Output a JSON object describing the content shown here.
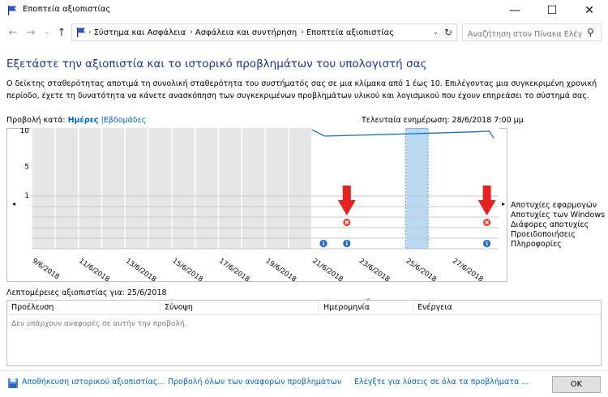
{
  "window": {
    "title": "Εποπτεία αξιοπιστίας",
    "minimize_glyph": "—",
    "maximize_glyph": "☐",
    "close_glyph": "✕"
  },
  "nav": {
    "back_glyph": "←",
    "forward_glyph": "→",
    "up_glyph": "↑",
    "history_glyph": "⌄",
    "breadcrumbs": [
      "Σύστημα και Ασφάλεια",
      "Ασφάλεια και συντήρηση",
      "Εποπτεία αξιοπιστίας"
    ],
    "refresh_glyph": "↻",
    "dropdown_glyph": "⌄",
    "search_placeholder": "Αναζήτηση στον Πίνακα Ελέγ...",
    "search_icon_glyph": "⚲"
  },
  "page": {
    "title": "Εξετάστε την αξιοπιστία και το ιστορικό προβλημάτων του υπολογιστή σας",
    "description": "Ο δείκτης σταθερότητας αποτιμά τη συνολική σταθερότητα του συστήματός σας σε μια κλίμακα από 1 έως 10. Επιλέγοντας μια συγκεκριμένη χρονική περίοδο, έχετε τη δυνατότητα να κάνετε ανασκόπηση των συγκεκριμένων προβλημάτων υλικού και λογισμικού που έχουν επηρεάσει το σύστημά σας.",
    "view_by_label": "Προβολή κατά:",
    "view_days": "Ημέρες",
    "view_sep": "|",
    "view_weeks": "Εβδομάδες",
    "last_update": "Τελευταία ενημέρωση: 28/6/2018 7:00 μμ"
  },
  "chart_data": {
    "type": "line",
    "title": "",
    "xlabel": "",
    "ylabel": "",
    "ylim": [
      1,
      10
    ],
    "y_ticks": [
      10,
      5,
      1
    ],
    "x_tick_labels": [
      "9/6/2018",
      "11/6/2018",
      "13/6/2018",
      "15/6/2018",
      "17/6/2018",
      "19/6/2018",
      "21/6/2018",
      "23/6/2018",
      "25/6/2018",
      "27/6/2018"
    ],
    "day_count": 20,
    "selected_day_index": 16,
    "no_data_day_count": 12,
    "stability_index": [
      {
        "day": 12,
        "value": 10
      },
      {
        "day": 12.55,
        "value": 9.1
      },
      {
        "day": 16,
        "value": 9.4
      },
      {
        "day": 19,
        "value": 9.7
      },
      {
        "day": 19.6,
        "value": 9.8
      },
      {
        "day": 19.8,
        "value": 8.8
      }
    ],
    "event_rows": [
      "Αποτυχίες εφαρμογών",
      "Αποτυχίες των Windows",
      "Διάφορες αποτυχίες",
      "Προειδοποιήσεις",
      "Πληροφορίες"
    ],
    "events": [
      {
        "day": 13,
        "row": 2,
        "kind": "error"
      },
      {
        "day": 19,
        "row": 2,
        "kind": "error"
      },
      {
        "day": 12,
        "row": 4,
        "kind": "info"
      },
      {
        "day": 13,
        "row": 4,
        "kind": "info"
      },
      {
        "day": 19,
        "row": 4,
        "kind": "info"
      }
    ],
    "annotation_arrows_days": [
      13,
      19
    ],
    "line_color": "#1a73c8",
    "selection_color": "#bcd9f2",
    "error_color": "#e8412c",
    "info_color": "#1e6ec8",
    "arrow_color": "#e52222"
  },
  "scroll": {
    "left_glyph": "◂",
    "right_glyph": "▸"
  },
  "details": {
    "title": "Λεπτομέρειες αξιοπιστίας για: 25/6/2018",
    "columns": [
      "Προέλευση",
      "Σύνοψη",
      "Ημερομηνία",
      "Ενέργεια"
    ],
    "sort_glyph": "^",
    "empty_message": "Δεν υπάρχουν αναφορές σε αυτήν την προβολή."
  },
  "footer": {
    "save_history": "Αποθήκευση ιστορικού αξιοπιστίας...",
    "view_all": "Προβολή όλων των αναφορών προβλημάτων",
    "check_solutions": "Ελέγξτε για λύσεις σε όλα τα προβλήματα ...",
    "ok": "OK"
  }
}
